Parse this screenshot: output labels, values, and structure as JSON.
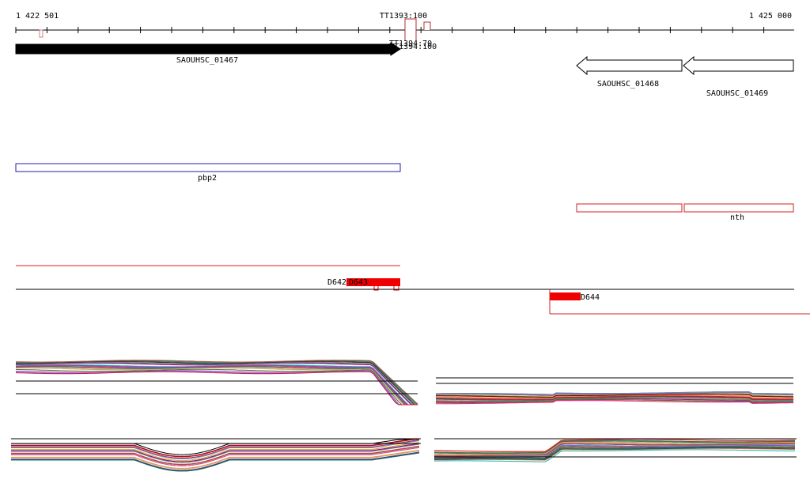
{
  "ruler": {
    "start_label": "1 422 501",
    "end_label": "1 425 000",
    "start": 1422501,
    "end": 1425000
  },
  "terminators": {
    "label_main": "TT1393:100",
    "label_overlap_a": "TT1394:70",
    "label_overlap_b": "TT1394:100"
  },
  "genes": [
    {
      "name": "SAOUHSC_01467",
      "strand": "+",
      "fill": "#000000"
    },
    {
      "name": "SAOUHSC_01468",
      "strand": "-",
      "fill": "#ffffff"
    },
    {
      "name": "SAOUHSC_01469",
      "strand": "-",
      "fill": "#ffffff"
    }
  ],
  "gene_names": {
    "pbp2": "pbp2",
    "nth": "nth"
  },
  "regions": {
    "d642": "D642",
    "d643": "D643",
    "d644": "D644"
  },
  "colors": {
    "gene_forward": "#000000",
    "annotation_blue": "#1f1fb3",
    "annotation_red": "#d42020",
    "region_red": "#ee0000",
    "terminator": "#b03030"
  }
}
